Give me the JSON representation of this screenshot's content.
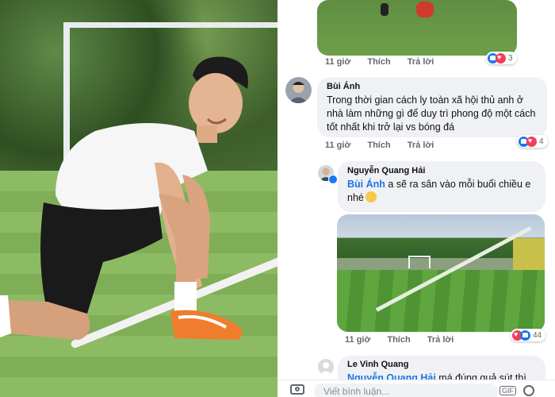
{
  "comments": [
    {
      "time": "11 giờ",
      "like_label": "Thích",
      "reply_label": "Trả lời",
      "reaction_count": "3"
    },
    {
      "author": "Bùi Ánh",
      "text": "Trong thời gian cách ly toàn xã hội thủ anh ở nhà làm những gì để duy trì phong độ một cách tốt nhất khi trở lại vs bóng đá",
      "time": "11 giờ",
      "like_label": "Thích",
      "reply_label": "Trả lời",
      "reaction_count": "4"
    },
    {
      "author": "Nguyễn Quang Hải",
      "mention": "Bùi Ánh",
      "text": " a sẽ ra sân vào mỗi buổi chiều e nhé",
      "time": "11 giờ",
      "like_label": "Thích",
      "reply_label": "Trả lời",
      "reaction_count": "44"
    },
    {
      "author": "Le Vinh Quang",
      "mention": "Nguyễn Quang Hải",
      "text": " má đúng quả sút thì"
    }
  ],
  "composer": {
    "placeholder": "Viết bình luận...",
    "gif_label": "GIF"
  },
  "icons": {
    "camera": "camera-icon",
    "emoji": "emoji-icon",
    "like": "like-reaction-icon",
    "heart": "heart-reaction-icon"
  },
  "colors": {
    "like_blue": "#1877f2",
    "heart_red": "#f33e58",
    "mention_blue": "#1b74e4",
    "bubble_bg": "#eff1f4"
  }
}
